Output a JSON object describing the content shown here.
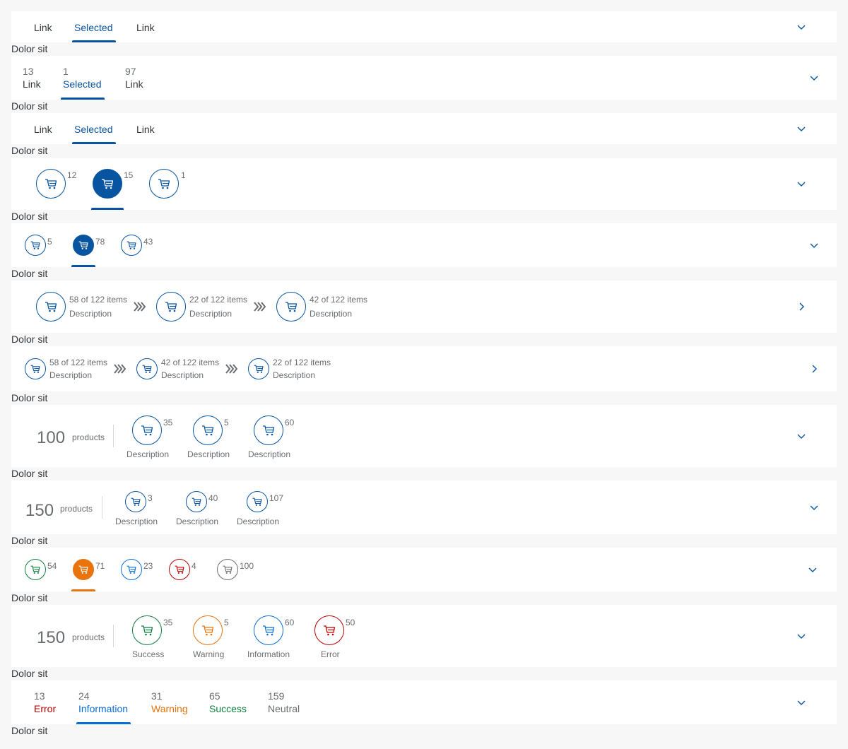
{
  "section_caption": "Dolor sit",
  "chevron_down": "chevron-down-icon",
  "chevron_right": "chevron-right-icon",
  "cart_icon": "cart-icon",
  "colors": {
    "accent": "#0854a0",
    "success": "#107e3e",
    "warning": "#e9730c",
    "error": "#bb0000",
    "information": "#0a6ed1",
    "neutral": "#6a6d70"
  },
  "bar1": {
    "tabs": [
      "Link",
      "Selected",
      "Link"
    ]
  },
  "bar2": {
    "tabs": [
      {
        "count": "13",
        "label": "Link"
      },
      {
        "count": "1",
        "label": "Selected"
      },
      {
        "count": "97",
        "label": "Link"
      }
    ]
  },
  "bar3": {
    "tabs": [
      "Link",
      "Selected",
      "Link"
    ]
  },
  "bar4": {
    "counts": [
      "12",
      "15",
      "1"
    ]
  },
  "bar5": {
    "counts": [
      "5",
      "78",
      "43"
    ]
  },
  "bar6": {
    "steps": [
      {
        "count": "58 of 122 items",
        "desc": "Description"
      },
      {
        "count": "22 of 122 items",
        "desc": "Description"
      },
      {
        "count": "42 of 122 items",
        "desc": "Description"
      }
    ]
  },
  "bar7": {
    "steps": [
      {
        "count": "58 of 122 items",
        "desc": "Description"
      },
      {
        "count": "42 of 122 items",
        "desc": "Description"
      },
      {
        "count": "22 of 122 items",
        "desc": "Description"
      }
    ]
  },
  "bar8": {
    "total": "100",
    "unit": "products",
    "items": [
      {
        "count": "35",
        "desc": "Description"
      },
      {
        "count": "5",
        "desc": "Description"
      },
      {
        "count": "60",
        "desc": "Description"
      }
    ]
  },
  "bar9": {
    "total": "150",
    "unit": "products",
    "items": [
      {
        "count": "3",
        "desc": "Description"
      },
      {
        "count": "40",
        "desc": "Description"
      },
      {
        "count": "107",
        "desc": "Description"
      }
    ]
  },
  "bar10": {
    "counts": [
      "54",
      "71",
      "23",
      "4",
      "100"
    ]
  },
  "bar11": {
    "total": "150",
    "unit": "products",
    "items": [
      {
        "count": "35",
        "desc": "Success"
      },
      {
        "count": "5",
        "desc": "Warning"
      },
      {
        "count": "60",
        "desc": "Information"
      },
      {
        "count": "50",
        "desc": "Error"
      }
    ]
  },
  "bar12": {
    "tabs": [
      {
        "count": "13",
        "label": "Error"
      },
      {
        "count": "24",
        "label": "Information"
      },
      {
        "count": "31",
        "label": "Warning"
      },
      {
        "count": "65",
        "label": "Success"
      },
      {
        "count": "159",
        "label": "Neutral"
      }
    ]
  }
}
